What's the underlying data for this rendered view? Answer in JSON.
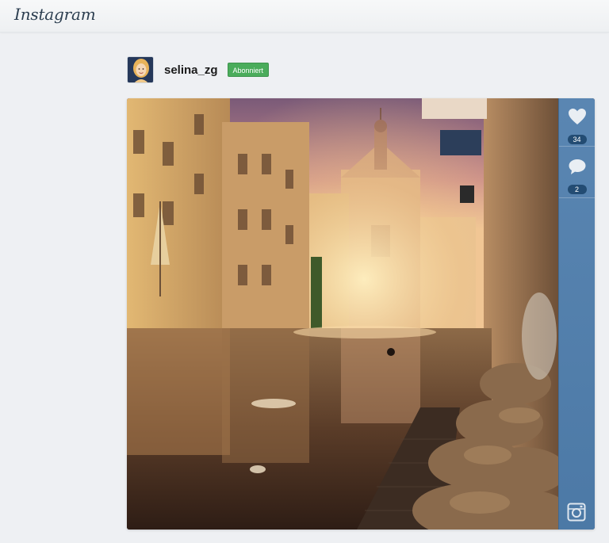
{
  "app": {
    "logo": "Instagram"
  },
  "profile": {
    "username": "selina_zg",
    "follow_badge": "Abonniert"
  },
  "post": {
    "likes": "34",
    "comments": "2"
  },
  "icons": {
    "like": "heart-icon",
    "comment": "comment-icon",
    "camera": "instagram-camera-icon"
  },
  "colors": {
    "accent_green": "#4aac5b",
    "sidebar_blue": "#5a86b2"
  }
}
